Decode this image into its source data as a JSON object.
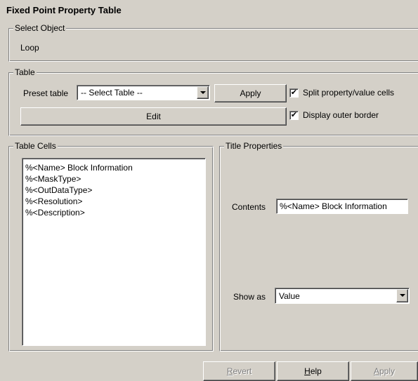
{
  "window": {
    "title": "Fixed Point Property Table"
  },
  "select_object": {
    "label": "Select Object",
    "value": "Loop"
  },
  "table": {
    "label": "Table",
    "preset_label": "Preset table",
    "preset_value": "-- Select Table --",
    "apply_label": "Apply",
    "edit_label": "Edit",
    "split_cells": {
      "label": "Split property/value cells",
      "checked": true,
      "mark": "✔"
    },
    "outer_border": {
      "label": "Display outer border",
      "checked": true,
      "mark": "✔"
    }
  },
  "table_cells": {
    "label": "Table Cells",
    "items": [
      "%<Name> Block Information",
      "%<MaskType>",
      "%<OutDataType>",
      "%<Resolution>",
      "%<Description>"
    ]
  },
  "title_properties": {
    "label": "Title Properties",
    "contents_label": "Contents",
    "contents_value": "%<Name> Block Information",
    "show_as_label": "Show as",
    "show_as_value": "Value"
  },
  "footer": {
    "revert": {
      "prefix": "",
      "accel": "R",
      "rest": "evert",
      "enabled": false
    },
    "help": {
      "prefix": "",
      "accel": "H",
      "rest": "elp",
      "enabled": true
    },
    "apply": {
      "prefix": "",
      "accel": "A",
      "rest": "pply",
      "enabled": false
    }
  }
}
